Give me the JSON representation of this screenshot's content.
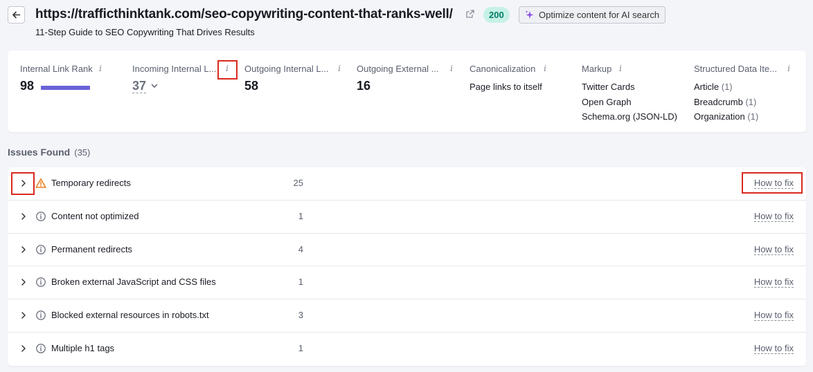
{
  "header": {
    "url": "https://trafficthinktank.com/seo-copywriting-content-that-ranks-well/",
    "status_code": "200",
    "ai_button_label": "Optimize content for AI search",
    "subtitle": "11-Step Guide to SEO Copywriting That Drives Results"
  },
  "metrics": {
    "internal_link_rank": {
      "label": "Internal Link Rank",
      "value": "98",
      "bar_fraction": 0.98
    },
    "incoming_internal": {
      "label": "Incoming Internal L...",
      "value": "37"
    },
    "outgoing_internal": {
      "label": "Outgoing Internal L...",
      "value": "58"
    },
    "outgoing_external": {
      "label": "Outgoing External ...",
      "value": "16"
    },
    "canonicalization": {
      "label": "Canonicalization",
      "value": "Page links to itself"
    },
    "markup": {
      "label": "Markup",
      "items": [
        "Twitter Cards",
        "Open Graph",
        "Schema.org (JSON-LD)"
      ]
    },
    "structured_data": {
      "label": "Structured Data Ite...",
      "items": [
        {
          "name": "Article",
          "count": "(1)"
        },
        {
          "name": "Breadcrumb",
          "count": "(1)"
        },
        {
          "name": "Organization",
          "count": "(1)"
        }
      ]
    }
  },
  "issues": {
    "title": "Issues Found",
    "count": "(35)",
    "how_to_fix_label": "How to fix",
    "rows": [
      {
        "name": "Temporary redirects",
        "count": "25",
        "severity": "warning"
      },
      {
        "name": "Content not optimized",
        "count": "1",
        "severity": "notice"
      },
      {
        "name": "Permanent redirects",
        "count": "4",
        "severity": "notice"
      },
      {
        "name": "Broken external JavaScript and CSS files",
        "count": "1",
        "severity": "notice"
      },
      {
        "name": "Blocked external resources in robots.txt",
        "count": "3",
        "severity": "notice"
      },
      {
        "name": "Multiple h1 tags",
        "count": "1",
        "severity": "notice"
      }
    ]
  },
  "colors": {
    "accent_bar": "#6a63d8",
    "status_badge_bg": "#c7f1e6",
    "status_badge_text": "#007c65",
    "warning_icon": "#f07d1c",
    "highlight_box": "#d9291c"
  }
}
